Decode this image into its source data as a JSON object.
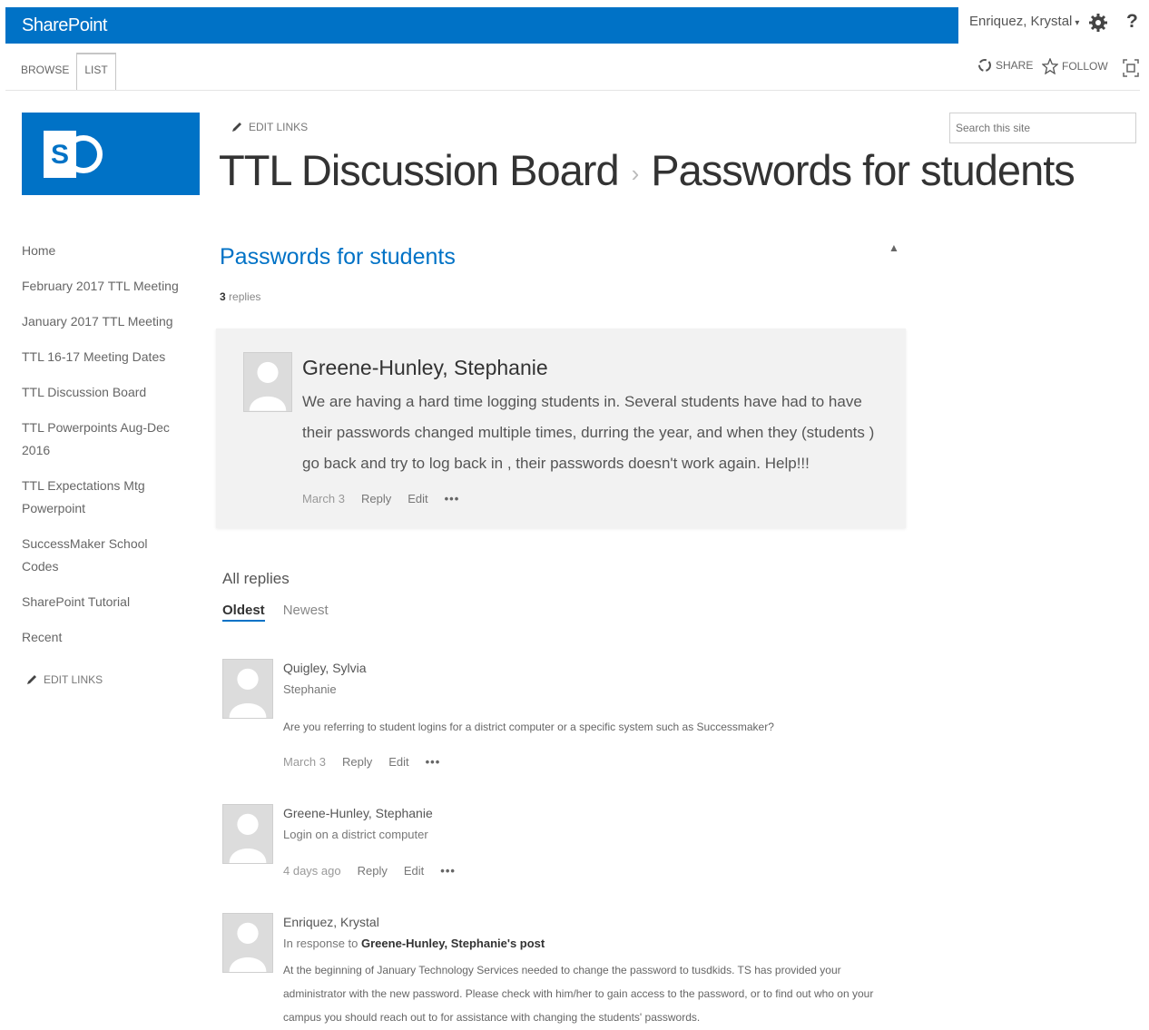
{
  "suite": {
    "brand": "SharePoint",
    "user": "Enriquez, Krystal"
  },
  "ribbon": {
    "tabs": [
      {
        "label": "BROWSE"
      },
      {
        "label": "LIST"
      }
    ],
    "share_label": "SHARE",
    "follow_label": "FOLLOW"
  },
  "site": {
    "edit_links": "EDIT LINKS",
    "title": "TTL Discussion Board",
    "separator": "›",
    "subtitle": "Passwords for students",
    "search_placeholder": "Search this site"
  },
  "nav": {
    "items": [
      {
        "label": "Home"
      },
      {
        "label": "February 2017 TTL Meeting"
      },
      {
        "label": "January 2017 TTL Meeting"
      },
      {
        "label": "TTL 16-17 Meeting Dates"
      },
      {
        "label": "TTL Discussion Board"
      },
      {
        "label": "TTL Powerpoints Aug-Dec 2016"
      },
      {
        "label": "TTL Expectations Mtg Powerpoint"
      },
      {
        "label": "SuccessMaker School Codes"
      },
      {
        "label": "SharePoint Tutorial"
      },
      {
        "label": "Recent"
      }
    ],
    "edit_links": "EDIT LINKS"
  },
  "thread": {
    "title": "Passwords for students",
    "reply_count": "3",
    "reply_word": "replies",
    "post": {
      "author": "Greene-Hunley, Stephanie",
      "body": "We are having a hard time logging students in.  Several students have had to have their passwords changed multiple times, durring the year, and when they (students ) go back and try to log back in , their passwords doesn't work again.  Help!!!",
      "date": "March 3",
      "reply": "Reply",
      "edit": "Edit",
      "more": "•••"
    },
    "all_replies": "All replies",
    "sort": {
      "oldest": "Oldest",
      "newest": "Newest"
    },
    "replies": [
      {
        "author": "Quigley, Sylvia",
        "line2": "Stephanie",
        "text": "Are you referring to student logins for a district computer or a specific system such as Successmaker?",
        "date": "March 3",
        "reply": "Reply",
        "edit": "Edit",
        "more": "•••"
      },
      {
        "author": "Greene-Hunley, Stephanie",
        "line2": "Login on a district computer",
        "date": "4 days ago",
        "reply": "Reply",
        "edit": "Edit",
        "more": "•••"
      },
      {
        "author": "Enriquez, Krystal",
        "in_response": "In response to",
        "in_response_target": "Greene-Hunley, Stephanie's post",
        "text": "At the beginning of January Technology Services needed to change the password to tusdkids. TS has provided your administrator with the new password. Please check with him/her to gain access to the password, or to find out who on your campus you should reach out to for assistance with changing the students' passwords."
      }
    ]
  },
  "colors": {
    "accent": "#0072c6"
  },
  "icons": [
    "gear-icon",
    "help-icon",
    "share-icon",
    "follow-star-icon",
    "focus-icon",
    "pencil-icon",
    "collapse-icon",
    "avatar-icon"
  ]
}
